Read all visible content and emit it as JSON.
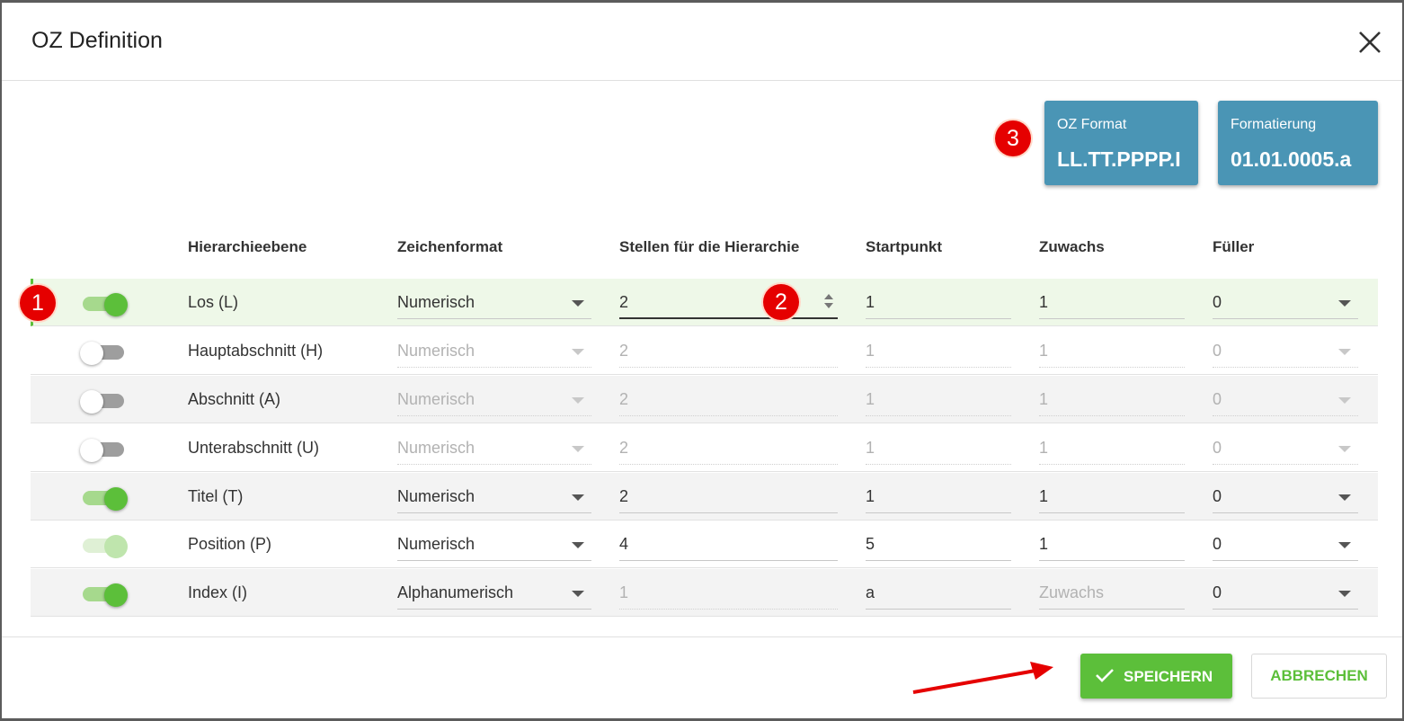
{
  "dialog": {
    "title": "OZ Definition"
  },
  "cards": [
    {
      "label": "OZ Format",
      "value": "LL.TT.PPPP.I"
    },
    {
      "label": "Formatierung",
      "value": "01.01.0005.a"
    }
  ],
  "annotations": [
    "1",
    "2",
    "3"
  ],
  "columns": {
    "hierarchy": "Hierarchieebene",
    "format": "Zeichenformat",
    "digits": "Stellen für die Hierarchie",
    "start": "Startpunkt",
    "increment": "Zuwachs",
    "filler": "Füller"
  },
  "rows": [
    {
      "name": "Los (L)",
      "format": "Numerisch",
      "digits": "2",
      "start": "1",
      "increment": "1",
      "filler": "0",
      "toggle": "on"
    },
    {
      "name": "Hauptabschnitt (H)",
      "format": "Numerisch",
      "digits": "2",
      "start": "1",
      "increment": "1",
      "filler": "0",
      "toggle": "off"
    },
    {
      "name": "Abschnitt (A)",
      "format": "Numerisch",
      "digits": "2",
      "start": "1",
      "increment": "1",
      "filler": "0",
      "toggle": "off"
    },
    {
      "name": "Unterabschnitt (U)",
      "format": "Numerisch",
      "digits": "2",
      "start": "1",
      "increment": "1",
      "filler": "0",
      "toggle": "off"
    },
    {
      "name": "Titel (T)",
      "format": "Numerisch",
      "digits": "2",
      "start": "1",
      "increment": "1",
      "filler": "0",
      "toggle": "on"
    },
    {
      "name": "Position (P)",
      "format": "Numerisch",
      "digits": "4",
      "start": "5",
      "increment": "1",
      "filler": "0",
      "toggle": "on-disabled"
    },
    {
      "name": "Index (I)",
      "format": "Alphanumerisch",
      "digits": "1",
      "start": "a",
      "increment": "",
      "increment_placeholder": "Zuwachs",
      "filler": "0",
      "toggle": "on"
    }
  ],
  "footer": {
    "save_label": "SPEICHERN",
    "cancel_label": "ABBRECHEN"
  },
  "colors": {
    "accent": "#5cbf3a",
    "card": "#4a95b5",
    "annotation": "#e50000"
  },
  "icons": {
    "close": "close-icon",
    "save": "check-icon",
    "select": "chevron-down-icon",
    "spinner": "spinner-icon"
  }
}
